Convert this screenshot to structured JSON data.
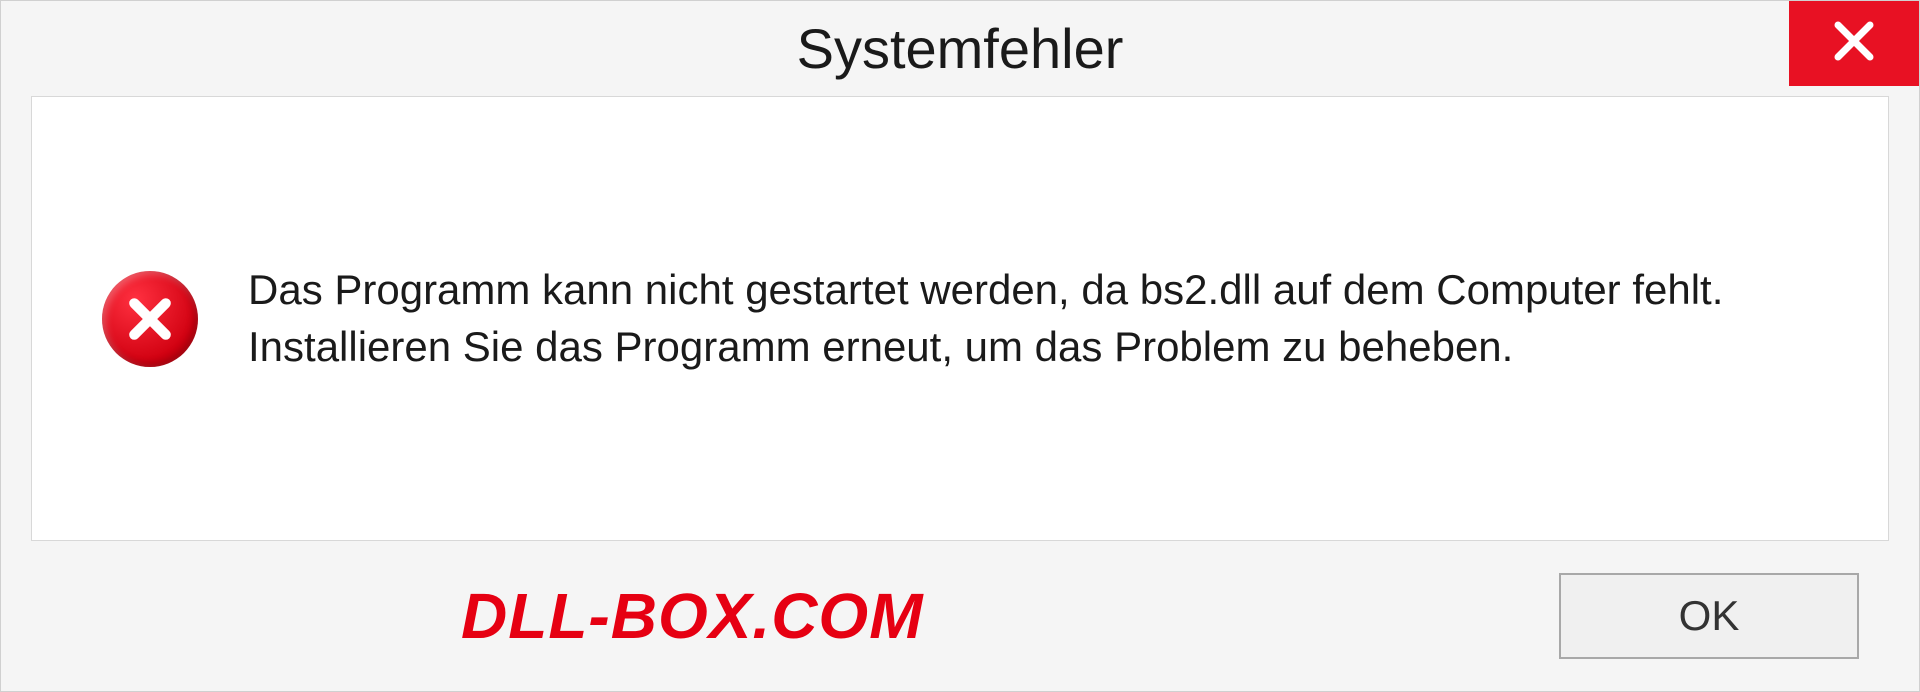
{
  "dialog": {
    "title": "Systemfehler",
    "message": "Das Programm kann nicht gestartet werden, da bs2.dll auf dem Computer fehlt. Installieren Sie das Programm erneut, um das Problem zu beheben.",
    "ok_label": "OK"
  },
  "watermark": "DLL-BOX.COM"
}
